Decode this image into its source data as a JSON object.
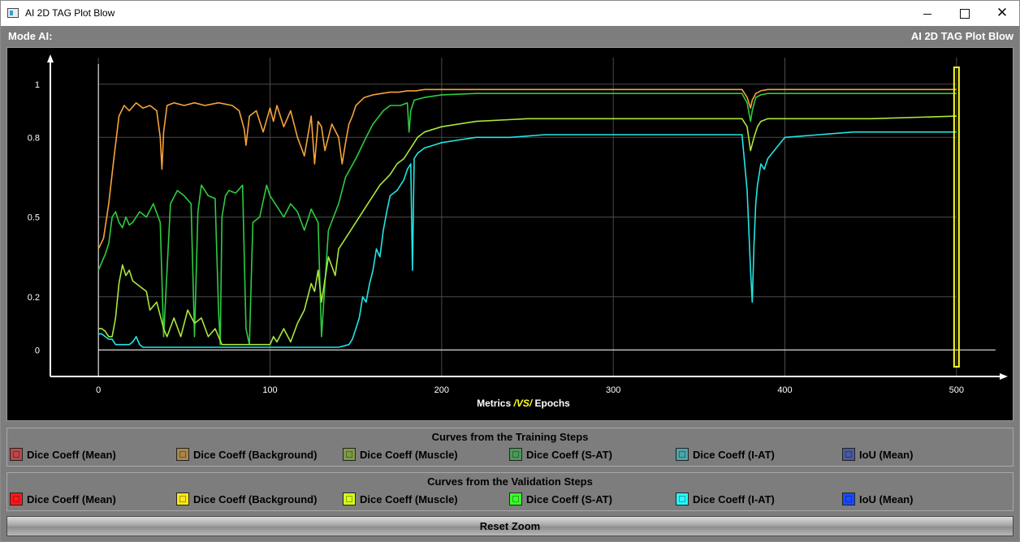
{
  "window": {
    "title": "AI 2D TAG Plot Blow",
    "controls": {
      "minimize": "–",
      "maximize": "□",
      "close": "✕"
    }
  },
  "header": {
    "mode_label": "Mode AI:",
    "plot_title": "AI 2D TAG Plot Blow"
  },
  "chart_data": {
    "type": "line",
    "xlabel_parts": [
      "Metrics ",
      "/VS/",
      " Epochs"
    ],
    "x_ticks": [
      "0",
      "100",
      "200",
      "300",
      "400",
      "500"
    ],
    "y_ticks": [
      "0",
      "0.2",
      "0.5",
      "0.8",
      "1"
    ],
    "xlim": [
      -28,
      528
    ],
    "ylim": [
      -0.1,
      1.1
    ],
    "grid": true,
    "marker_epoch": 500,
    "marker_color": "#ffff22",
    "series": [
      {
        "name": "Dice Coeff (Background)",
        "color": "#f5a33a",
        "x": [
          0,
          3,
          6,
          9,
          12,
          15,
          18,
          22,
          26,
          30,
          34,
          36,
          37,
          38,
          40,
          44,
          50,
          56,
          62,
          70,
          78,
          82,
          85,
          86,
          88,
          92,
          96,
          100,
          102,
          104,
          108,
          112,
          116,
          120,
          124,
          126,
          128,
          130,
          132,
          136,
          140,
          142,
          144,
          146,
          148,
          150,
          155,
          160,
          165,
          170,
          175,
          180,
          185,
          190,
          200,
          220,
          250,
          300,
          350,
          375,
          378,
          380,
          381,
          383,
          386,
          390,
          400,
          450,
          500
        ],
        "y": [
          0.38,
          0.42,
          0.55,
          0.72,
          0.88,
          0.92,
          0.9,
          0.93,
          0.91,
          0.92,
          0.9,
          0.8,
          0.68,
          0.82,
          0.92,
          0.93,
          0.92,
          0.93,
          0.92,
          0.93,
          0.92,
          0.9,
          0.83,
          0.77,
          0.88,
          0.9,
          0.82,
          0.91,
          0.86,
          0.92,
          0.84,
          0.9,
          0.8,
          0.73,
          0.88,
          0.7,
          0.86,
          0.84,
          0.75,
          0.85,
          0.8,
          0.7,
          0.78,
          0.85,
          0.88,
          0.92,
          0.95,
          0.96,
          0.965,
          0.97,
          0.97,
          0.975,
          0.975,
          0.98,
          0.98,
          0.98,
          0.98,
          0.98,
          0.98,
          0.98,
          0.95,
          0.91,
          0.94,
          0.965,
          0.975,
          0.98,
          0.98,
          0.98,
          0.98
        ]
      },
      {
        "name": "Dice Coeff (S-AT)",
        "color": "#2ecc40",
        "x": [
          0,
          2,
          4,
          6,
          8,
          10,
          12,
          14,
          16,
          18,
          20,
          24,
          28,
          32,
          36,
          38,
          42,
          46,
          50,
          54,
          56,
          58,
          60,
          64,
          68,
          70,
          71,
          72,
          74,
          76,
          80,
          84,
          86,
          88,
          90,
          94,
          98,
          100,
          104,
          108,
          112,
          116,
          120,
          124,
          128,
          130,
          134,
          140,
          144,
          150,
          156,
          160,
          166,
          170,
          176,
          180,
          181,
          182,
          184,
          190,
          200,
          220,
          250,
          300,
          350,
          375,
          378,
          380,
          381,
          383,
          386,
          390,
          400,
          450,
          500
        ],
        "y": [
          0.3,
          0.33,
          0.36,
          0.4,
          0.5,
          0.52,
          0.48,
          0.46,
          0.5,
          0.47,
          0.48,
          0.52,
          0.5,
          0.55,
          0.48,
          0.05,
          0.55,
          0.6,
          0.58,
          0.55,
          0.05,
          0.52,
          0.62,
          0.58,
          0.57,
          0.15,
          0.02,
          0.5,
          0.58,
          0.6,
          0.59,
          0.62,
          0.08,
          0.02,
          0.48,
          0.5,
          0.62,
          0.58,
          0.54,
          0.5,
          0.55,
          0.52,
          0.45,
          0.53,
          0.48,
          0.05,
          0.45,
          0.55,
          0.65,
          0.72,
          0.8,
          0.85,
          0.9,
          0.92,
          0.92,
          0.93,
          0.82,
          0.9,
          0.94,
          0.95,
          0.96,
          0.965,
          0.965,
          0.965,
          0.965,
          0.965,
          0.93,
          0.86,
          0.9,
          0.95,
          0.96,
          0.965,
          0.965,
          0.965,
          0.965
        ]
      },
      {
        "name": "Dice Coeff (Muscle)",
        "color": "#a9e83a",
        "x": [
          0,
          2,
          4,
          6,
          8,
          10,
          12,
          14,
          16,
          18,
          20,
          24,
          28,
          30,
          34,
          38,
          40,
          44,
          48,
          52,
          56,
          60,
          64,
          68,
          70,
          72,
          74,
          78,
          80,
          84,
          90,
          96,
          100,
          102,
          104,
          108,
          112,
          116,
          120,
          124,
          126,
          128,
          130,
          134,
          138,
          140,
          144,
          150,
          156,
          160,
          164,
          170,
          174,
          178,
          182,
          186,
          190,
          200,
          220,
          250,
          300,
          350,
          375,
          378,
          380,
          382,
          384,
          386,
          390,
          400,
          450,
          500
        ],
        "y": [
          0.08,
          0.08,
          0.07,
          0.05,
          0.05,
          0.12,
          0.25,
          0.32,
          0.28,
          0.3,
          0.26,
          0.24,
          0.22,
          0.15,
          0.18,
          0.08,
          0.05,
          0.12,
          0.05,
          0.15,
          0.1,
          0.12,
          0.05,
          0.08,
          0.05,
          0.02,
          0.02,
          0.02,
          0.02,
          0.02,
          0.02,
          0.02,
          0.02,
          0.05,
          0.03,
          0.08,
          0.03,
          0.1,
          0.15,
          0.25,
          0.22,
          0.3,
          0.18,
          0.35,
          0.28,
          0.38,
          0.42,
          0.48,
          0.54,
          0.58,
          0.62,
          0.66,
          0.7,
          0.72,
          0.76,
          0.8,
          0.82,
          0.84,
          0.86,
          0.87,
          0.87,
          0.87,
          0.87,
          0.84,
          0.75,
          0.8,
          0.84,
          0.86,
          0.87,
          0.87,
          0.87,
          0.88
        ]
      },
      {
        "name": "Dice Coeff (I-AT)",
        "color": "#22e6e6",
        "x": [
          0,
          2,
          4,
          6,
          8,
          10,
          14,
          18,
          20,
          22,
          24,
          26,
          30,
          40,
          60,
          80,
          100,
          120,
          140,
          146,
          148,
          150,
          152,
          154,
          156,
          158,
          160,
          162,
          164,
          166,
          168,
          170,
          174,
          178,
          180,
          182,
          183,
          184,
          186,
          190,
          195,
          200,
          210,
          220,
          240,
          260,
          280,
          300,
          320,
          340,
          360,
          375,
          378,
          380,
          381,
          382,
          383,
          384,
          386,
          388,
          390,
          395,
          400,
          420,
          440,
          460,
          480,
          500
        ],
        "y": [
          0.06,
          0.06,
          0.05,
          0.04,
          0.04,
          0.02,
          0.02,
          0.02,
          0.03,
          0.05,
          0.02,
          0.01,
          0.01,
          0.01,
          0.01,
          0.01,
          0.01,
          0.01,
          0.01,
          0.02,
          0.04,
          0.08,
          0.12,
          0.2,
          0.18,
          0.25,
          0.3,
          0.38,
          0.35,
          0.45,
          0.52,
          0.58,
          0.6,
          0.64,
          0.68,
          0.7,
          0.3,
          0.72,
          0.74,
          0.76,
          0.77,
          0.78,
          0.79,
          0.8,
          0.8,
          0.81,
          0.81,
          0.81,
          0.81,
          0.81,
          0.81,
          0.81,
          0.6,
          0.3,
          0.18,
          0.4,
          0.55,
          0.62,
          0.7,
          0.68,
          0.72,
          0.76,
          0.8,
          0.81,
          0.82,
          0.82,
          0.82,
          0.82
        ]
      }
    ]
  },
  "legend_training": {
    "title": "Curves from the Training Steps",
    "items": [
      {
        "label": "Dice Coeff (Mean)",
        "color": "#b84a4a",
        "icon": "square-swatch"
      },
      {
        "label": "Dice Coeff (Background)",
        "color": "#a8864a",
        "icon": "square-swatch"
      },
      {
        "label": "Dice Coeff (Muscle)",
        "color": "#7e9a48",
        "icon": "square-swatch"
      },
      {
        "label": "Dice Coeff (S-AT)",
        "color": "#4a9a5a",
        "icon": "square-swatch"
      },
      {
        "label": "Dice Coeff (I-AT)",
        "color": "#4ea4a8",
        "icon": "square-swatch"
      },
      {
        "label": "IoU (Mean)",
        "color": "#4a5a9a",
        "icon": "square-swatch"
      }
    ]
  },
  "legend_validation": {
    "title": "Curves from the Validation Steps",
    "items": [
      {
        "label": "Dice Coeff (Mean)",
        "color": "#ff1a1a",
        "icon": "square-swatch"
      },
      {
        "label": "Dice Coeff (Background)",
        "color": "#ffe81a",
        "icon": "square-swatch"
      },
      {
        "label": "Dice Coeff (Muscle)",
        "color": "#d8ff1a",
        "icon": "square-swatch"
      },
      {
        "label": "Dice Coeff (S-AT)",
        "color": "#3aff2a",
        "icon": "square-swatch"
      },
      {
        "label": "Dice Coeff (I-AT)",
        "color": "#2afaff",
        "icon": "square-swatch"
      },
      {
        "label": "IoU (Mean)",
        "color": "#1a4aff",
        "icon": "square-swatch"
      }
    ]
  },
  "footer": {
    "reset_label": "Reset Zoom"
  }
}
